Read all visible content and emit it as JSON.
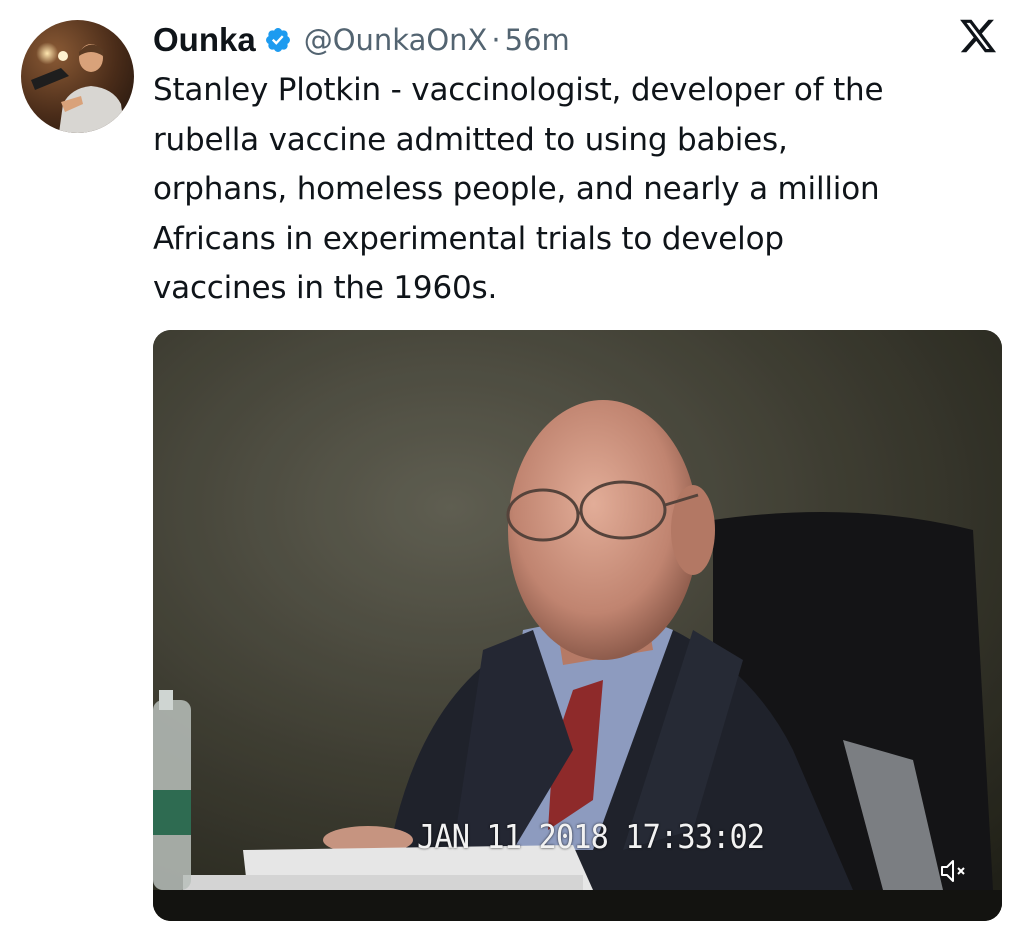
{
  "author": {
    "name": "Ounka",
    "handle": "@OunkaOnX",
    "separator": "·",
    "time_ago": "56m",
    "verified": true
  },
  "tweet": {
    "lines": [
      "Stanley Plotkin - vaccinologist, developer of the",
      "rubella vaccine admitted to using babies,",
      "orphans, homeless people, and nearly a million",
      "Africans in experimental trials to develop",
      "vaccines in the 1960s."
    ]
  },
  "media": {
    "overlay_timestamp": "JAN 11 2018  17:33:02",
    "muted": true
  },
  "icons": {
    "verified": "verified-badge-icon",
    "platform": "x-logo-icon",
    "mute": "speaker-muted-icon"
  },
  "colors": {
    "verified_blue": "#1d9bf0",
    "secondary_text": "#536471",
    "primary_text": "#0f1419"
  }
}
